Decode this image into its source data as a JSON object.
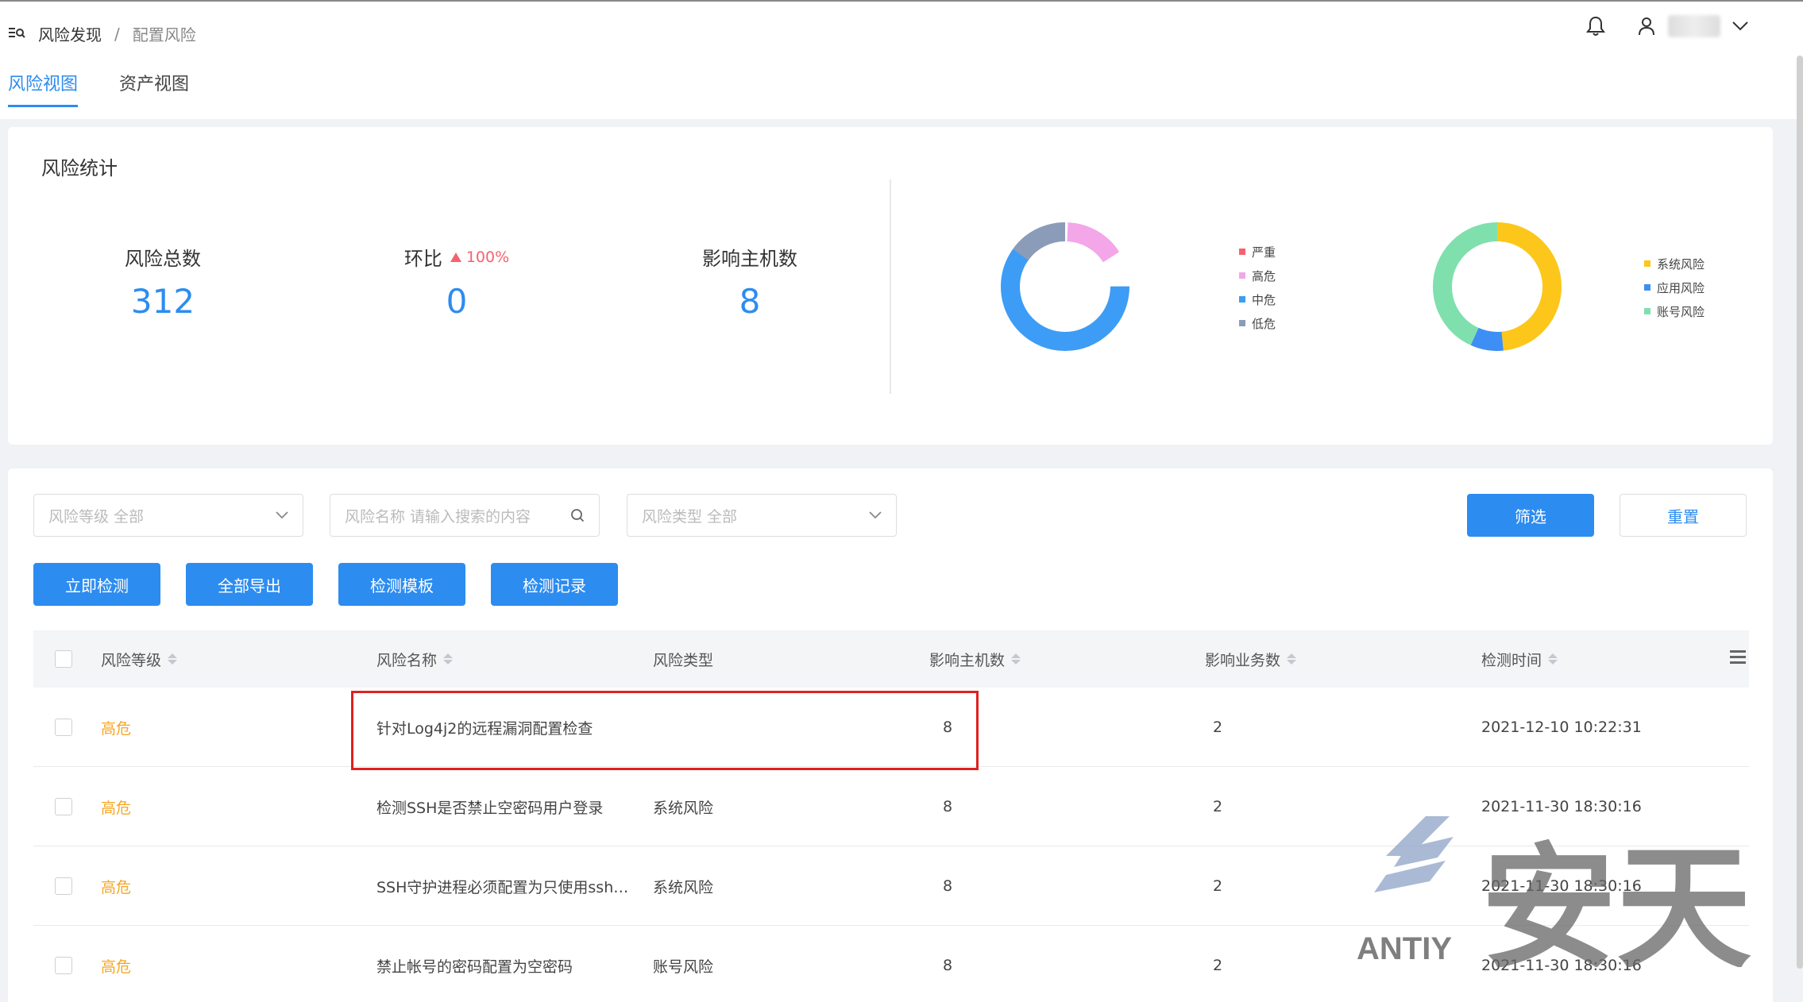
{
  "breadcrumb": {
    "root": "风险发现",
    "separator": "/",
    "current": "配置风险"
  },
  "tabs": [
    {
      "label": "风险视图",
      "active": true
    },
    {
      "label": "资产视图",
      "active": false
    }
  ],
  "stats": {
    "title": "风险统计",
    "total_label": "风险总数",
    "total_value": "312",
    "ratio_label": "环比",
    "ratio_change": "100%",
    "ratio_value": "0",
    "hosts_label": "影响主机数",
    "hosts_value": "8"
  },
  "level_legend": [
    {
      "label": "严重",
      "color": "#f5626f"
    },
    {
      "label": "高危",
      "color": "#f3a6e8"
    },
    {
      "label": "中危",
      "color": "#3d9cf5"
    },
    {
      "label": "低危",
      "color": "#8b9cb8"
    }
  ],
  "type_legend": [
    {
      "label": "系统风险",
      "color": "#fcc71a"
    },
    {
      "label": "应用风险",
      "color": "#3d8ef5"
    },
    {
      "label": "账号风险",
      "color": "#7fe0ad"
    }
  ],
  "filters": {
    "level": "风险等级 全部",
    "name": "风险名称 请输入搜索的内容",
    "type": "风险类型 全部",
    "filter_btn": "筛选",
    "reset_btn": "重置"
  },
  "actions": {
    "detect_now": "立即检测",
    "export_all": "全部导出",
    "template": "检测模板",
    "records": "检测记录"
  },
  "table": {
    "columns": [
      "风险等级",
      "风险名称",
      "风险类型",
      "影响主机数",
      "影响业务数",
      "检测时间"
    ],
    "rows": [
      {
        "level": "高危",
        "name": "针对Log4j2的远程漏洞配置检查",
        "type": "",
        "hosts": "8",
        "business": "2",
        "time": "2021-12-10 10:22:31"
      },
      {
        "level": "高危",
        "name": "检测SSH是否禁止空密码用户登录",
        "type": "系统风险",
        "hosts": "8",
        "business": "2",
        "time": "2021-11-30 18:30:16"
      },
      {
        "level": "高危",
        "name": "SSH守护进程必须配置为只使用ssh…",
        "type": "系统风险",
        "hosts": "8",
        "business": "2",
        "time": "2021-11-30 18:30:16"
      },
      {
        "level": "高危",
        "name": "禁止帐号的密码配置为空密码",
        "type": "账号风险",
        "hosts": "8",
        "business": "2",
        "time": "2021-11-30 18:30:16"
      }
    ]
  },
  "watermark": {
    "logo_text": "ANTIY",
    "chinese": "安天"
  }
}
